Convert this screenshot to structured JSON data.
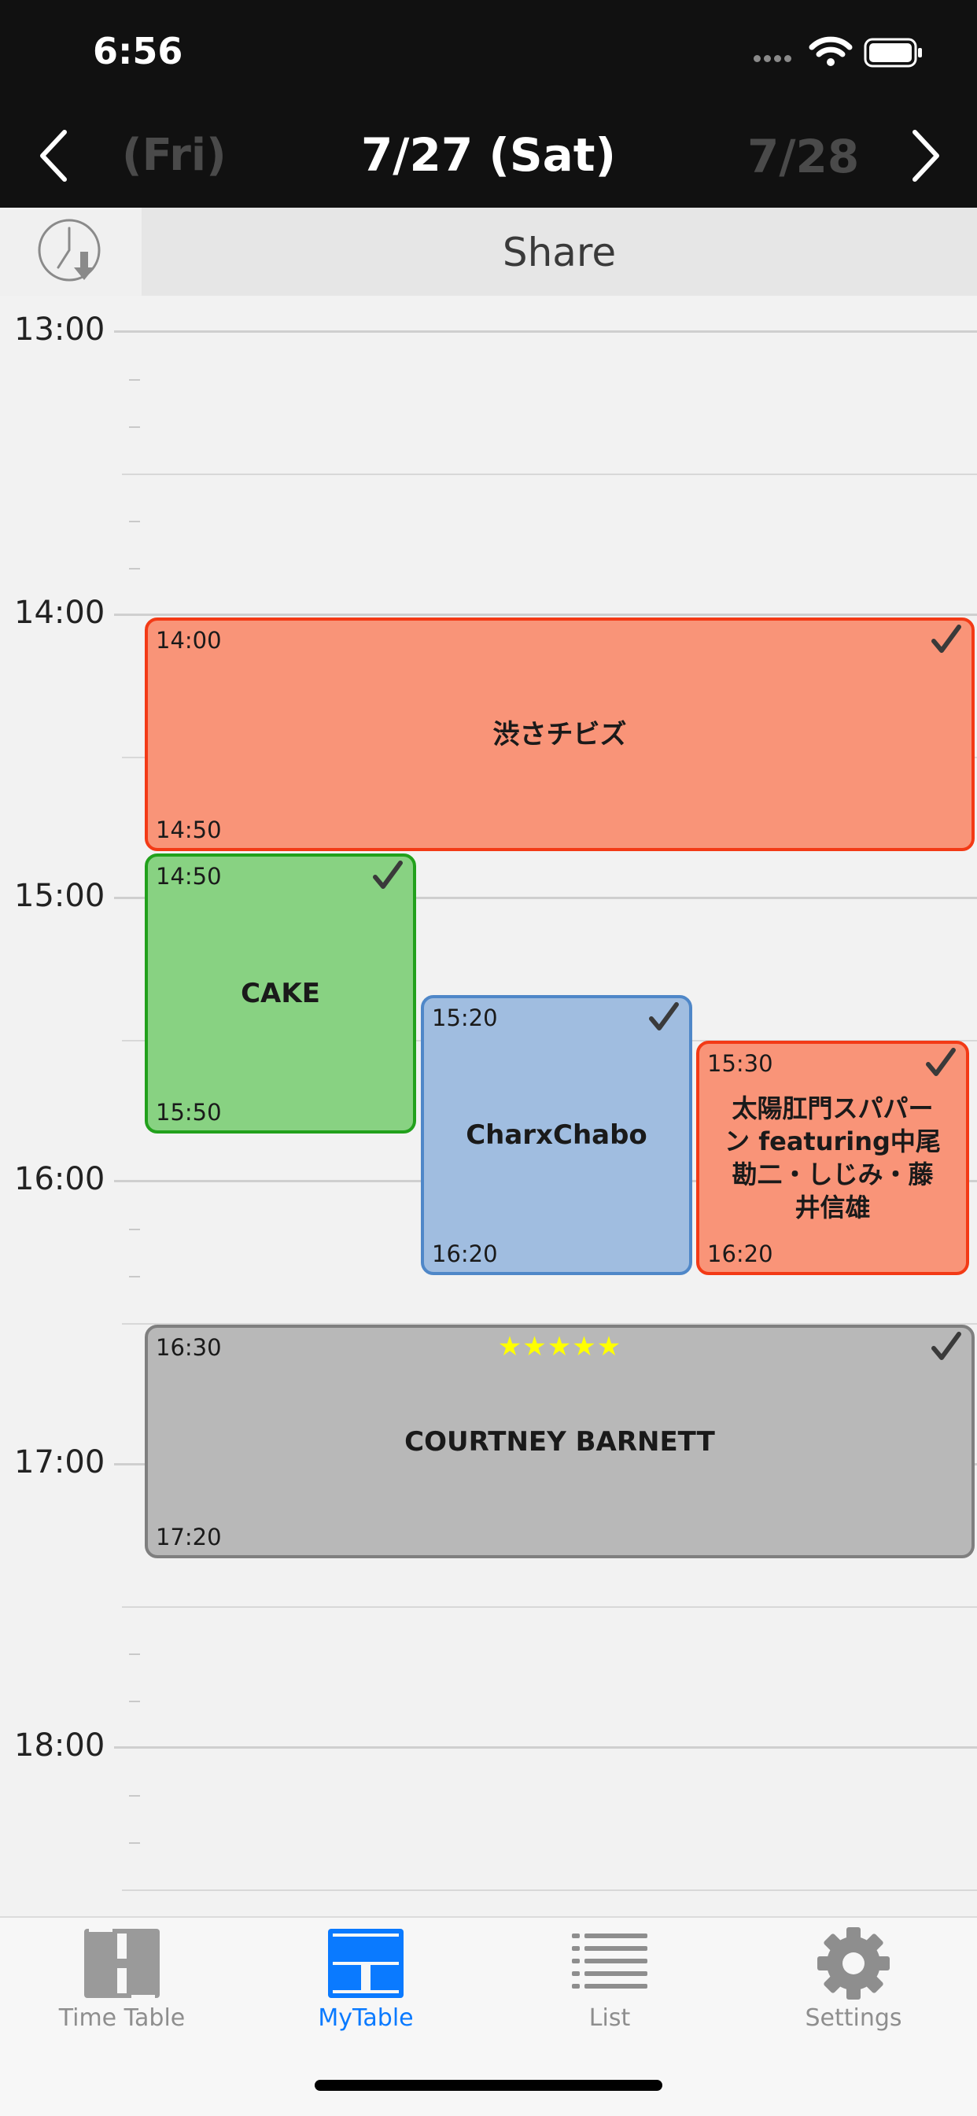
{
  "status_bar": {
    "time": "6:56"
  },
  "header": {
    "prev_date": "(Fri)",
    "current_date": "7/27 (Sat)",
    "next_date": "7/28"
  },
  "share_bar": {
    "label": "Share",
    "clock_icon": "clock-download-icon"
  },
  "timeline": {
    "hours": [
      "13:00",
      "14:00",
      "15:00",
      "16:00",
      "17:00",
      "18:00"
    ]
  },
  "events": [
    {
      "start": "14:00",
      "end": "14:50",
      "title": "渋さチビズ",
      "checked": true,
      "color": "#f99478",
      "border": "#f33a16"
    },
    {
      "start": "14:50",
      "end": "15:50",
      "title": "CAKE",
      "checked": true,
      "color": "#88d282",
      "border": "#22a11c"
    },
    {
      "start": "15:20",
      "end": "16:20",
      "title": "CharxChabo",
      "checked": true,
      "color": "#a0bde0",
      "border": "#4f87c8"
    },
    {
      "start": "15:30",
      "end": "16:20",
      "title": "太陽肛門スパパーン featuring中尾勘二・しじみ・藤井信雄",
      "checked": true,
      "color": "#f99478",
      "border": "#f33a16"
    },
    {
      "start": "16:30",
      "end": "17:20",
      "title": "COURTNEY BARNETT",
      "checked": true,
      "rating": "★★★★★",
      "color": "#b8b8b8",
      "border": "#7f7f7f"
    }
  ],
  "tabbar": {
    "tabs": [
      {
        "label": "Time Table",
        "icon": "timetable-icon",
        "active": false
      },
      {
        "label": "MyTable",
        "icon": "mytable-icon",
        "active": true
      },
      {
        "label": "List",
        "icon": "list-icon",
        "active": false
      },
      {
        "label": "Settings",
        "icon": "gear-icon",
        "active": false
      }
    ],
    "active_color": "#0a7aff",
    "inactive_color": "#8e8e8e"
  }
}
